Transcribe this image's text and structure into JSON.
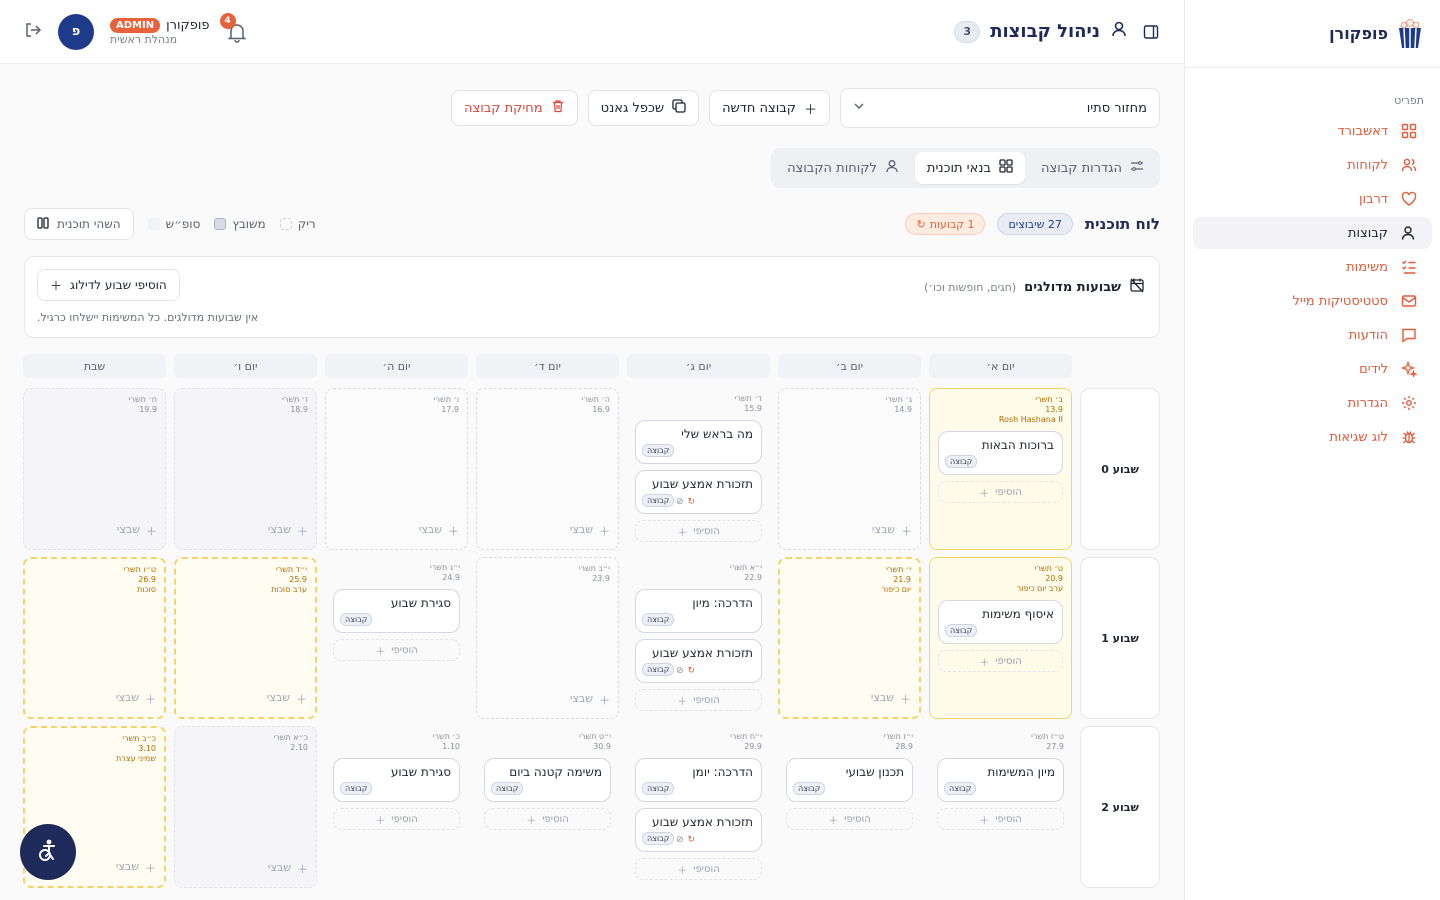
{
  "brand": {
    "name": "פופקורן"
  },
  "sidebar": {
    "section": "תפריט",
    "items": [
      {
        "label": "דאשבורד",
        "icon": "grid-icon"
      },
      {
        "label": "לקוחות",
        "icon": "users-icon"
      },
      {
        "label": "דרבון",
        "icon": "heart-icon"
      },
      {
        "label": "קבוצות",
        "icon": "user-group-icon",
        "active": true
      },
      {
        "label": "משימות",
        "icon": "list-check-icon"
      },
      {
        "label": "סטטיסטיקות מייל",
        "icon": "mail-icon"
      },
      {
        "label": "הודעות",
        "icon": "message-icon"
      },
      {
        "label": "לידים",
        "icon": "sparkle-icon"
      },
      {
        "label": "הגדרות",
        "icon": "settings-icon"
      },
      {
        "label": "לוג שגיאות",
        "icon": "bug-icon"
      }
    ]
  },
  "header": {
    "title": "ניהול קבוצות",
    "count": "3",
    "user_name": "פופקורן",
    "user_badge": "ADMIN",
    "user_role": "מנהלת ראשית",
    "avatar_letter": "פ",
    "notifications": "4"
  },
  "toolbar": {
    "select_value": "מחזור סתיו",
    "new_group": "קבוצה חדשה",
    "gantt_copy": "שכפל גאנט",
    "delete_group": "מחיקת קבוצה"
  },
  "tabs": [
    {
      "label": "הגדרות קבוצה",
      "active": false
    },
    {
      "label": "בנאי תוכנית",
      "active": true
    },
    {
      "label": "לקוחות הקבוצה",
      "active": false
    }
  ],
  "board": {
    "title": "לוח תוכנית",
    "assigned": "27 שיבוצים",
    "repeating": "1 קבועות",
    "legend_weekend": "סופ״ש",
    "legend_assigned": "משובץ",
    "legend_empty": "ריק",
    "hide_btn": "השהי תוכנית"
  },
  "special_weeks": {
    "title": "שבועות מדולגים",
    "subtitle": "(חגים, חופשות וכו׳)",
    "add_btn": "הוסיפי שבוע לדילוג",
    "empty": "אין שבועות מדולגים. כל המשימות יישלחו כרגיל."
  },
  "days": [
    "יום א׳",
    "יום ב׳",
    "יום ג׳",
    "יום ד׳",
    "יום ה׳",
    "יום ו׳",
    "שבת"
  ],
  "labels": {
    "add": "הוסיפי",
    "assign": "שבצי",
    "tag": "קבוצה"
  },
  "weeks": [
    {
      "label": "שבוע 0",
      "cells": [
        {
          "style": "cur",
          "heb": "ב׳ תשרי",
          "num": "13.9",
          "hol": "Rosh Hashana II",
          "tasks": [
            {
              "title": "ברוכות הבאות"
            }
          ],
          "add": true
        },
        {
          "style": "open-dash",
          "heb": "ג׳ תשרי",
          "num": "14.9",
          "hol": "",
          "tasks": [],
          "assign": true
        },
        {
          "style": "open",
          "heb": "ד׳ תשרי",
          "num": "15.9",
          "hol": "",
          "tasks": [
            {
              "title": "מה בראש שלי"
            },
            {
              "title": "תזכורת אמצע שבוע",
              "rep": true
            }
          ],
          "add": true
        },
        {
          "style": "open-dash",
          "heb": "ה׳ תשרי",
          "num": "16.9",
          "hol": "",
          "tasks": [],
          "assign": true
        },
        {
          "style": "open-dash",
          "heb": "ו׳ תשרי",
          "num": "17.9",
          "hol": "",
          "tasks": [],
          "assign": true
        },
        {
          "style": "wk",
          "heb": "ז׳ תשרי",
          "num": "18.9",
          "hol": "",
          "tasks": [],
          "assign": true
        },
        {
          "style": "wk",
          "heb": "ח׳ תשרי",
          "num": "19.9",
          "hol": "",
          "tasks": [],
          "assign": true
        }
      ]
    },
    {
      "label": "שבוע 1",
      "cells": [
        {
          "style": "cur",
          "heb": "ט׳ תשרי",
          "num": "20.9",
          "hol": "ערב יום כיפור",
          "tasks": [
            {
              "title": "איסוף משימות"
            }
          ],
          "add": true
        },
        {
          "style": "holiday",
          "heb": "י׳ תשרי",
          "num": "21.9",
          "hol": "יום כיפור",
          "tasks": [],
          "assign": true
        },
        {
          "style": "open",
          "heb": "י״א תשרי",
          "num": "22.9",
          "hol": "",
          "tasks": [
            {
              "title": "הדרכה: מיון"
            },
            {
              "title": "תזכורת אמצע שבוע",
              "rep": true
            }
          ],
          "add": true
        },
        {
          "style": "open-dash",
          "heb": "י״ב תשרי",
          "num": "23.9",
          "hol": "",
          "tasks": [],
          "assign": true
        },
        {
          "style": "open",
          "heb": "י״ג תשרי",
          "num": "24.9",
          "hol": "",
          "tasks": [
            {
              "title": "סגירת שבוע"
            }
          ],
          "add": true
        },
        {
          "style": "holiday",
          "heb": "י״ד תשרי",
          "num": "25.9",
          "hol": "ערב סוכות",
          "tasks": [],
          "assign": true
        },
        {
          "style": "holiday",
          "heb": "ט״ו תשרי",
          "num": "26.9",
          "hol": "סוכות",
          "tasks": [],
          "assign": true
        }
      ]
    },
    {
      "label": "שבוע 2",
      "cells": [
        {
          "style": "open",
          "heb": "ט״ז תשרי",
          "num": "27.9",
          "hol": "",
          "tasks": [
            {
              "title": "מיון המשימות"
            }
          ],
          "add": true
        },
        {
          "style": "open",
          "heb": "י״ז תשרי",
          "num": "28.9",
          "hol": "",
          "tasks": [
            {
              "title": "תכנון שבועי"
            }
          ],
          "add": true
        },
        {
          "style": "open",
          "heb": "י״ח תשרי",
          "num": "29.9",
          "hol": "",
          "tasks": [
            {
              "title": "הדרכה: יומן"
            },
            {
              "title": "תזכורת אמצע שבוע",
              "rep": true
            }
          ],
          "add": true
        },
        {
          "style": "open",
          "heb": "י״ט תשרי",
          "num": "30.9",
          "hol": "",
          "tasks": [
            {
              "title": "משימה קטנה ביום"
            }
          ],
          "add": true
        },
        {
          "style": "open",
          "heb": "כ׳ תשרי",
          "num": "1.10",
          "hol": "",
          "tasks": [
            {
              "title": "סגירת שבוע"
            }
          ],
          "add": true
        },
        {
          "style": "wk",
          "heb": "כ״א תשרי",
          "num": "2.10",
          "hol": "",
          "tasks": [],
          "assign": true
        },
        {
          "style": "holiday",
          "heb": "כ״ב תשרי",
          "num": "3.10",
          "hol": "שמיני עצרת",
          "tasks": [],
          "assign": true
        }
      ]
    }
  ],
  "colors": {
    "accent": "#e25b3a",
    "navy": "#1e2a5a",
    "holiday": "#f3d36a"
  }
}
